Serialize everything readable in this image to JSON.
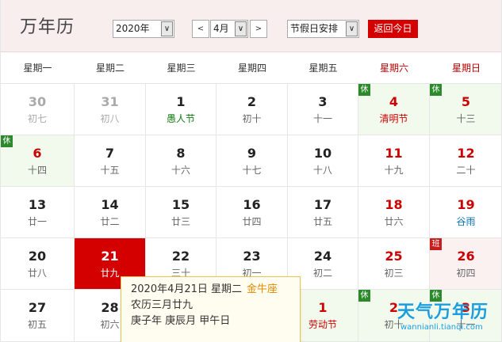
{
  "header": {
    "title": "万年历",
    "year_select": "2020年",
    "month_select": "4月",
    "prev_symbol": "<",
    "next_symbol": ">",
    "holiday_select": "节假日安排",
    "today_button": "返回今日",
    "dropdown_arrow": "∨"
  },
  "weekdays": [
    "星期一",
    "星期二",
    "星期三",
    "星期四",
    "星期五",
    "星期六",
    "星期日"
  ],
  "badges": {
    "rest": "休",
    "work": "班"
  },
  "weeks": [
    [
      {
        "day": "30",
        "lunar": "初七",
        "muted": true
      },
      {
        "day": "31",
        "lunar": "初八",
        "muted": true
      },
      {
        "day": "1",
        "lunar": "愚人节",
        "fest": "green"
      },
      {
        "day": "2",
        "lunar": "初十"
      },
      {
        "day": "3",
        "lunar": "十一"
      },
      {
        "day": "4",
        "lunar": "清明节",
        "red": true,
        "fest": "red",
        "bg": "green",
        "badge": "rest"
      },
      {
        "day": "5",
        "lunar": "十三",
        "red": true,
        "bg": "green",
        "badge": "rest"
      }
    ],
    [
      {
        "day": "6",
        "lunar": "十四",
        "red": true,
        "bg": "green",
        "badge": "rest"
      },
      {
        "day": "7",
        "lunar": "十五"
      },
      {
        "day": "8",
        "lunar": "十六"
      },
      {
        "day": "9",
        "lunar": "十七"
      },
      {
        "day": "10",
        "lunar": "十八"
      },
      {
        "day": "11",
        "lunar": "十九",
        "red": true
      },
      {
        "day": "12",
        "lunar": "二十",
        "red": true
      }
    ],
    [
      {
        "day": "13",
        "lunar": "廿一"
      },
      {
        "day": "14",
        "lunar": "廿二"
      },
      {
        "day": "15",
        "lunar": "廿三"
      },
      {
        "day": "16",
        "lunar": "廿四"
      },
      {
        "day": "17",
        "lunar": "廿五"
      },
      {
        "day": "18",
        "lunar": "廿六",
        "red": true
      },
      {
        "day": "19",
        "lunar": "谷雨",
        "red": true,
        "fest": "blue"
      }
    ],
    [
      {
        "day": "20",
        "lunar": "廿八"
      },
      {
        "day": "21",
        "lunar": "廿九",
        "selected": true
      },
      {
        "day": "22",
        "lunar": "三十"
      },
      {
        "day": "23",
        "lunar": "初一"
      },
      {
        "day": "24",
        "lunar": "初二"
      },
      {
        "day": "25",
        "lunar": "初三",
        "red": true
      },
      {
        "day": "26",
        "lunar": "初四",
        "red": true,
        "bg": "pink",
        "badge": "work"
      }
    ],
    [
      {
        "day": "27",
        "lunar": "初五"
      },
      {
        "day": "28",
        "lunar": "初六"
      },
      {
        "day": "",
        "lunar": ""
      },
      {
        "day": "",
        "lunar": ""
      },
      {
        "day": "1",
        "lunar": "劳动节",
        "red": true,
        "fest": "red",
        "bg": "green",
        "badge": "rest"
      },
      {
        "day": "2",
        "lunar": "初十",
        "red": true,
        "bg": "green",
        "badge": "rest"
      },
      {
        "day": "3",
        "lunar": "十一",
        "red": true,
        "bg": "green",
        "badge": "rest"
      }
    ]
  ],
  "tooltip": {
    "date": "2020年4月21日 星期二",
    "zodiac": "金牛座",
    "lunar": "农历三月廿九",
    "ganzhi": "庚子年 庚辰月 甲午日"
  },
  "watermark": {
    "cn": "天气万年历",
    "en": "wannianli.tianqi.com"
  }
}
